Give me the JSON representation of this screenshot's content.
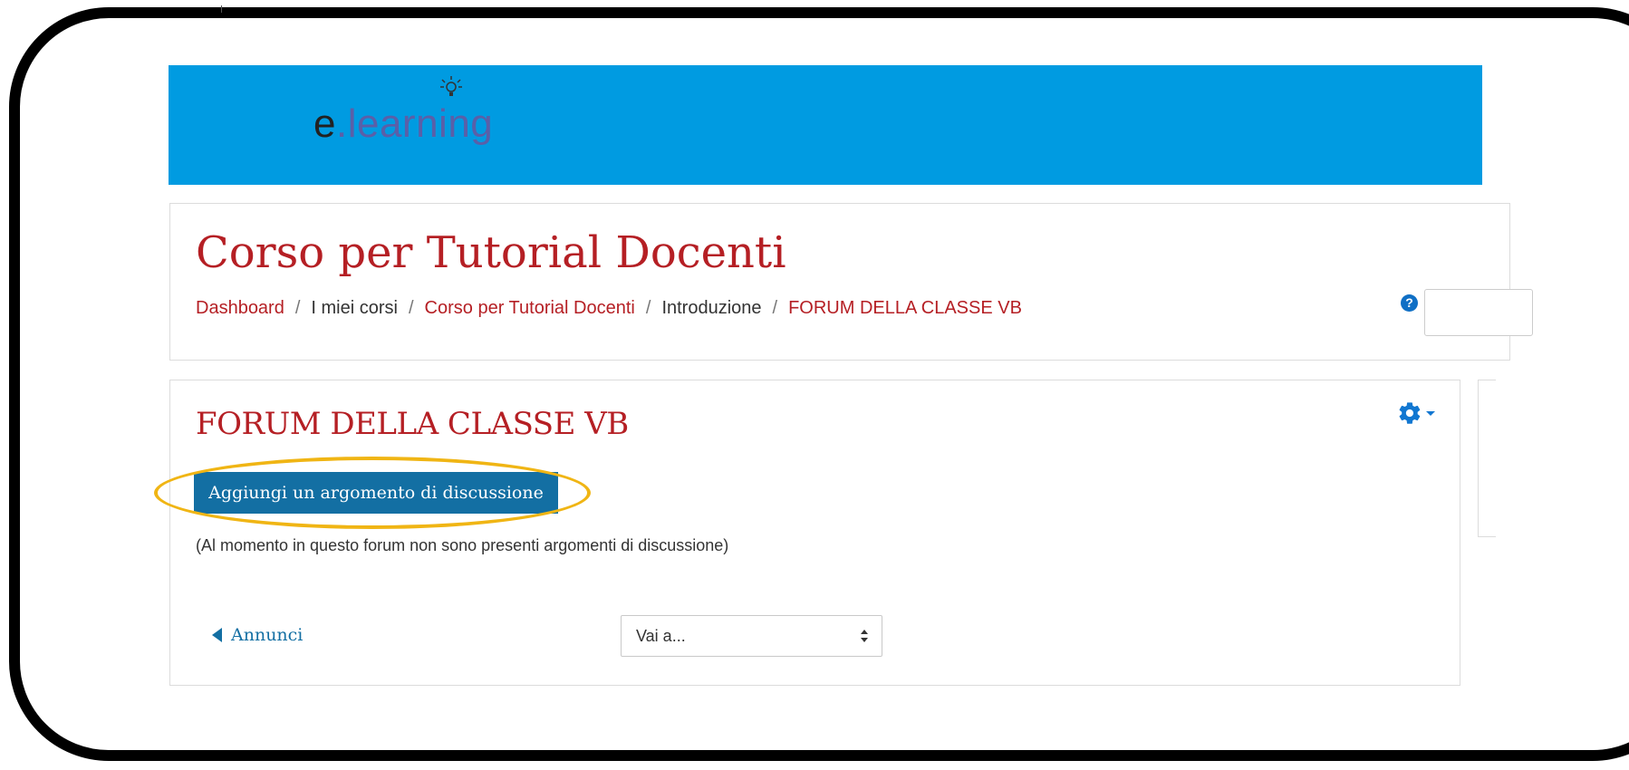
{
  "header": {
    "logo_e": "e",
    "logo_rest": ".learning"
  },
  "course": {
    "title": "Corso per Tutorial Docenti",
    "breadcrumb": [
      {
        "label": "Dashboard",
        "link": true
      },
      {
        "label": "I miei corsi",
        "link": false
      },
      {
        "label": "Corso per Tutorial Docenti",
        "link": true
      },
      {
        "label": "Introduzione",
        "link": false
      },
      {
        "label": "FORUM DELLA CLASSE VB",
        "link": true
      }
    ],
    "breadcrumb_separator": "/",
    "help_icon": "question-circle-icon"
  },
  "forum": {
    "title": "FORUM DELLA CLASSE VB",
    "add_discussion_label": "Aggiungi un argomento di discussione",
    "empty_message": "(Al momento in questo forum non sono presenti argomenti di discussione)",
    "prev_activity_label": "Annunci",
    "jump_select": {
      "selected": "Vai a..."
    },
    "settings_icon": "gear-icon"
  },
  "colors": {
    "navbar": "#009be1",
    "title_red": "#b51f24",
    "button_blue": "#136fa3",
    "highlight_ring": "#f0b514"
  }
}
